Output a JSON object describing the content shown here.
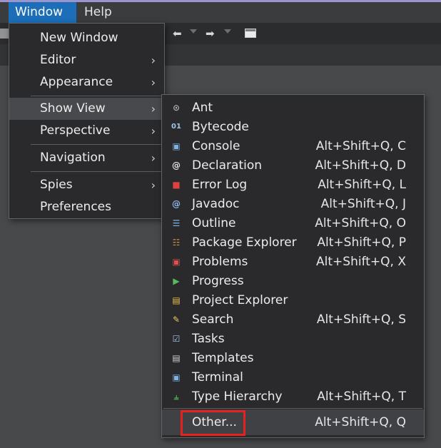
{
  "menubar": {
    "items": [
      {
        "label": "Window",
        "active": true
      },
      {
        "label": "Help",
        "active": false
      }
    ]
  },
  "toolbar": {
    "icons": [
      "back-arrow-icon",
      "forward-arrow-icon",
      "open-perspective-icon"
    ]
  },
  "window_menu": {
    "items": [
      {
        "label": "New Window",
        "submenu": false
      },
      {
        "label": "Editor",
        "submenu": true
      },
      {
        "label": "Appearance",
        "submenu": true
      },
      {
        "label": "Show View",
        "submenu": true,
        "highlighted": true
      },
      {
        "label": "Perspective",
        "submenu": true
      },
      {
        "label": "Navigation",
        "submenu": true
      },
      {
        "label": "Spies",
        "submenu": true
      },
      {
        "label": "Preferences",
        "submenu": false
      }
    ]
  },
  "show_view_menu": {
    "items": [
      {
        "label": "Ant",
        "shortcut": "",
        "icon": "ant-icon"
      },
      {
        "label": "Bytecode",
        "shortcut": "",
        "icon": "bytecode-icon"
      },
      {
        "label": "Console",
        "shortcut": "Alt+Shift+Q, C",
        "icon": "console-icon"
      },
      {
        "label": "Declaration",
        "shortcut": "Alt+Shift+Q, D",
        "icon": "declaration-icon"
      },
      {
        "label": "Error Log",
        "shortcut": "Alt+Shift+Q, L",
        "icon": "error-log-icon"
      },
      {
        "label": "Javadoc",
        "shortcut": "Alt+Shift+Q, J",
        "icon": "javadoc-icon"
      },
      {
        "label": "Outline",
        "shortcut": "Alt+Shift+Q, O",
        "icon": "outline-icon"
      },
      {
        "label": "Package Explorer",
        "shortcut": "Alt+Shift+Q, P",
        "icon": "package-explorer-icon"
      },
      {
        "label": "Problems",
        "shortcut": "Alt+Shift+Q, X",
        "icon": "problems-icon"
      },
      {
        "label": "Progress",
        "shortcut": "",
        "icon": "progress-icon"
      },
      {
        "label": "Project Explorer",
        "shortcut": "",
        "icon": "project-explorer-icon"
      },
      {
        "label": "Search",
        "shortcut": "Alt+Shift+Q, S",
        "icon": "search-icon"
      },
      {
        "label": "Tasks",
        "shortcut": "",
        "icon": "tasks-icon"
      },
      {
        "label": "Templates",
        "shortcut": "",
        "icon": "templates-icon"
      },
      {
        "label": "Terminal",
        "shortcut": "",
        "icon": "terminal-icon"
      },
      {
        "label": "Type Hierarchy",
        "shortcut": "Alt+Shift+Q, T",
        "icon": "type-hierarchy-icon"
      }
    ],
    "other": {
      "label": "Other...",
      "shortcut": "Alt+Shift+Q, Q",
      "icon": "other-views-icon"
    }
  },
  "colors": {
    "menubar_active": "#1c6eb9",
    "menu_background": "#2a2a2c",
    "highlight_box": "#e5221d"
  }
}
